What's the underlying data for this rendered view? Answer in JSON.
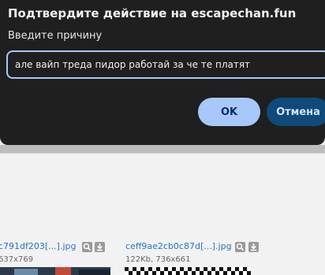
{
  "dialog": {
    "title": "Подтвердите действие на escapechan.fun",
    "prompt_label": "Введите причину",
    "input_value": "але вайп треда пидор работай за че те платят",
    "ok_label": "OK",
    "cancel_label": "Отмена"
  },
  "thumbnails": [
    {
      "filename": "c791df203[...].jpg",
      "meta": "637x769"
    },
    {
      "filename": "ceff9ae2cb0c87d[...].jpg",
      "meta": "122Kb, 736x661"
    }
  ],
  "colors": {
    "dialog_bg": "#1f1f1f",
    "accent": "#a8c7fa",
    "cancel_bg": "#0e4a7a",
    "link": "#2a72c2"
  }
}
